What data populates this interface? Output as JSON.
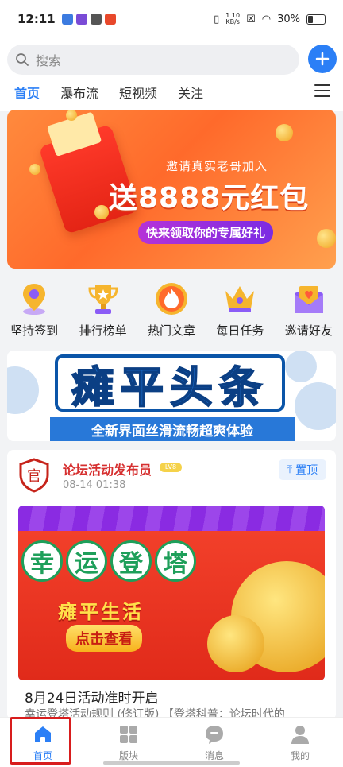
{
  "status_bar": {
    "time": "12:11",
    "net_speed_top": "1.10",
    "net_speed_unit": "KB/s",
    "battery": "30%"
  },
  "search": {
    "placeholder": "搜索"
  },
  "tabs": [
    {
      "label": "首页",
      "active": true
    },
    {
      "label": "瀑布流",
      "active": false
    },
    {
      "label": "短视频",
      "active": false
    },
    {
      "label": "关注",
      "active": false
    }
  ],
  "banner": {
    "line1": "邀请真实老哥加入",
    "line2": "送8888元红包",
    "line3": "快来领取你的专属好礼"
  },
  "quick_actions": [
    {
      "label": "坚持签到",
      "icon": "location-pin-icon"
    },
    {
      "label": "排行榜单",
      "icon": "trophy-icon"
    },
    {
      "label": "热门文章",
      "icon": "flame-icon"
    },
    {
      "label": "每日任务",
      "icon": "crown-icon"
    },
    {
      "label": "邀请好友",
      "icon": "envelope-heart-icon"
    }
  ],
  "promo": {
    "headline": "瘫平头条",
    "sub": "全新界面丝滑流畅超爽体验"
  },
  "post": {
    "avatar_text": "官",
    "author": "论坛活动发布员",
    "level": "LV8",
    "time": "08-14 01:38",
    "pin_label": "置顶",
    "image": {
      "chars": [
        "幸",
        "运",
        "登",
        "塔"
      ],
      "subtitle": "瘫平生活",
      "button": "点击查看"
    },
    "title": "8月24日活动准时开启",
    "summary": "幸运登塔活动规则 (修订版) 【登塔科普：论坛时代的"
  },
  "bottom_nav": [
    {
      "label": "首页",
      "active": true
    },
    {
      "label": "版块",
      "active": false
    },
    {
      "label": "消息",
      "active": false
    },
    {
      "label": "我的",
      "active": false
    }
  ],
  "colors": {
    "accent": "#2b7ff6",
    "author_red": "#d62f2f",
    "banner_orange": "#ff6a2b"
  }
}
